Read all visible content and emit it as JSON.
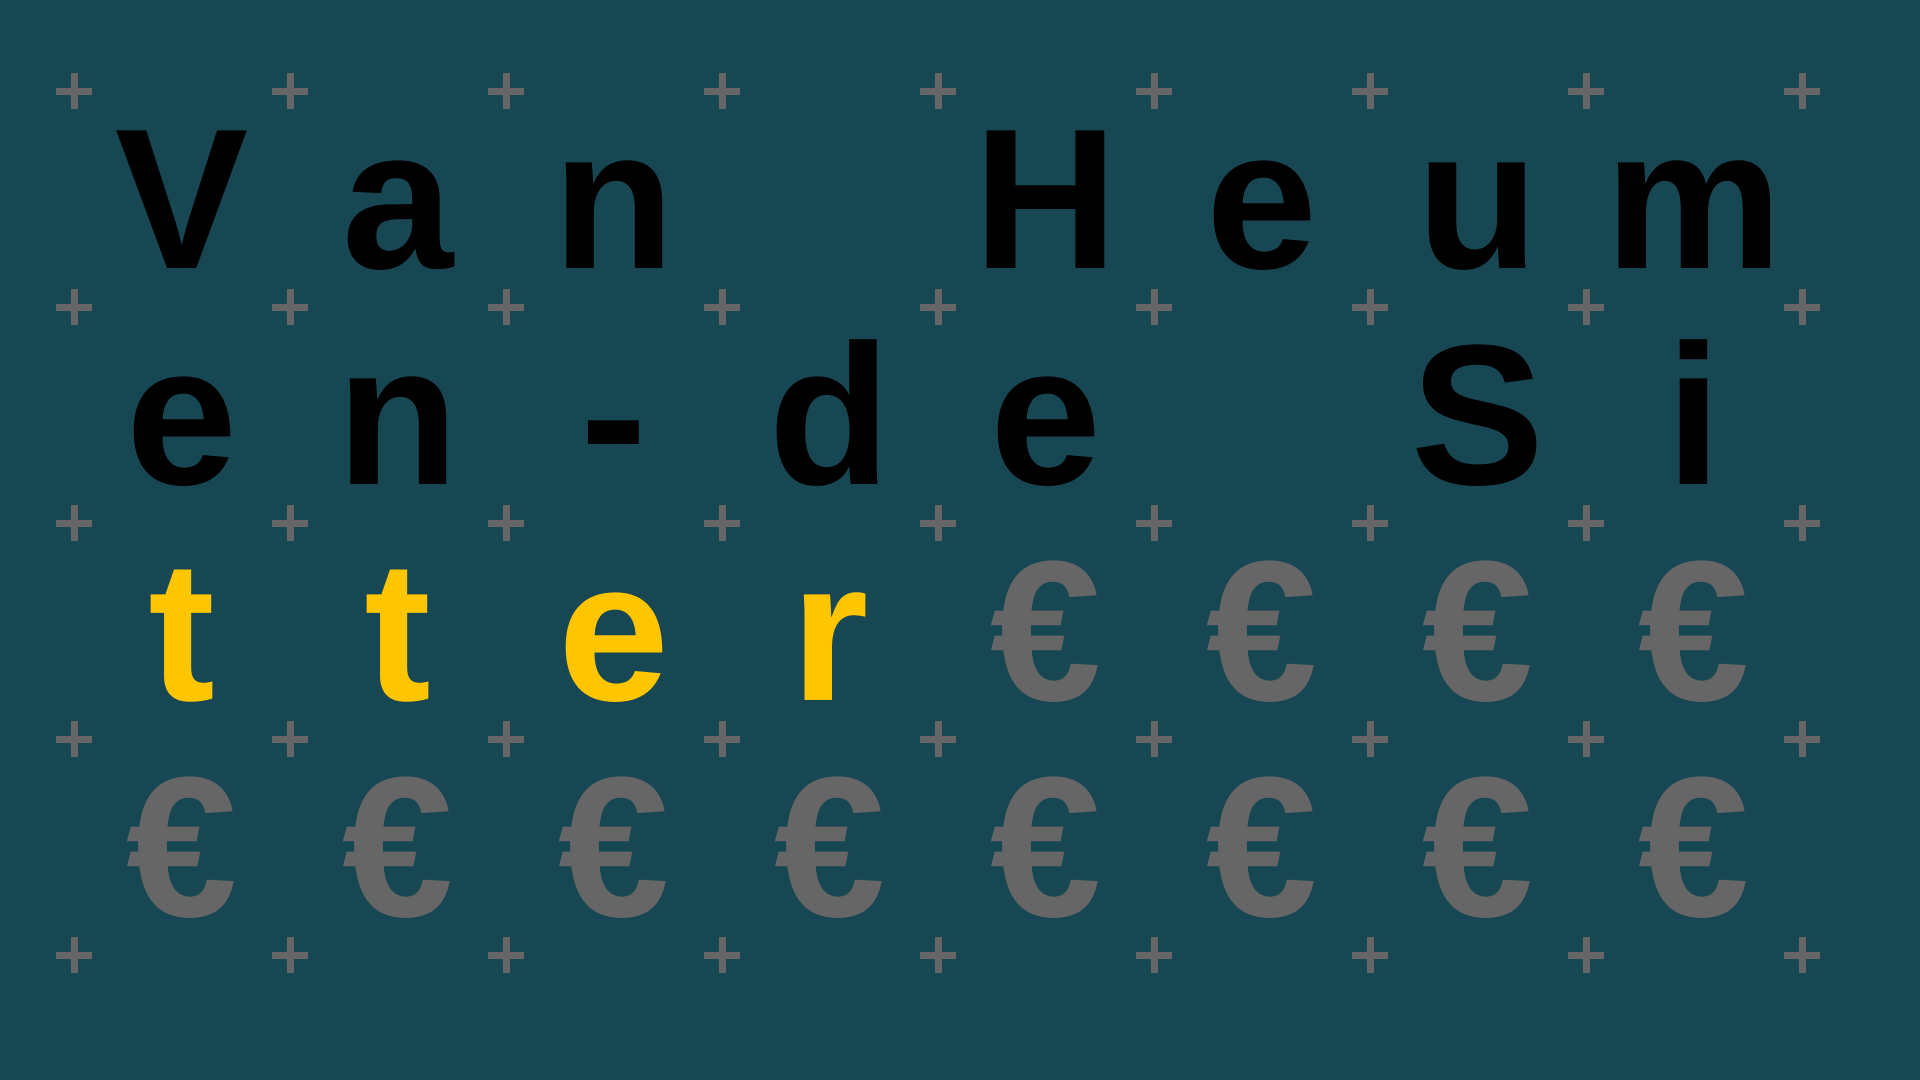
{
  "title": "Van Heumen-de Sitter",
  "colors": {
    "background": "#184754",
    "text": "#000000",
    "highlight": "#ffc600",
    "filler": "#666666",
    "plus": "#666666"
  },
  "rows": [
    [
      {
        "c": "V",
        "k": "black"
      },
      {
        "c": "a",
        "k": "black"
      },
      {
        "c": "n",
        "k": "black"
      },
      {
        "c": " ",
        "k": "black"
      },
      {
        "c": "H",
        "k": "black"
      },
      {
        "c": "e",
        "k": "black"
      },
      {
        "c": "u",
        "k": "black"
      },
      {
        "c": "m",
        "k": "black"
      }
    ],
    [
      {
        "c": "e",
        "k": "black"
      },
      {
        "c": "n",
        "k": "black"
      },
      {
        "c": "-",
        "k": "black"
      },
      {
        "c": "d",
        "k": "black"
      },
      {
        "c": "e",
        "k": "black"
      },
      {
        "c": " ",
        "k": "black"
      },
      {
        "c": "S",
        "k": "black"
      },
      {
        "c": "i",
        "k": "black"
      }
    ],
    [
      {
        "c": "t",
        "k": "yellow"
      },
      {
        "c": "t",
        "k": "yellow"
      },
      {
        "c": "e",
        "k": "yellow"
      },
      {
        "c": "r",
        "k": "yellow"
      },
      {
        "c": "€",
        "k": "gray"
      },
      {
        "c": "€",
        "k": "gray"
      },
      {
        "c": "€",
        "k": "gray"
      },
      {
        "c": "€",
        "k": "gray"
      }
    ],
    [
      {
        "c": "€",
        "k": "gray"
      },
      {
        "c": "€",
        "k": "gray"
      },
      {
        "c": "€",
        "k": "gray"
      },
      {
        "c": "€",
        "k": "gray"
      },
      {
        "c": "€",
        "k": "gray"
      },
      {
        "c": "€",
        "k": "gray"
      },
      {
        "c": "€",
        "k": "gray"
      },
      {
        "c": "€",
        "k": "gray"
      }
    ]
  ]
}
